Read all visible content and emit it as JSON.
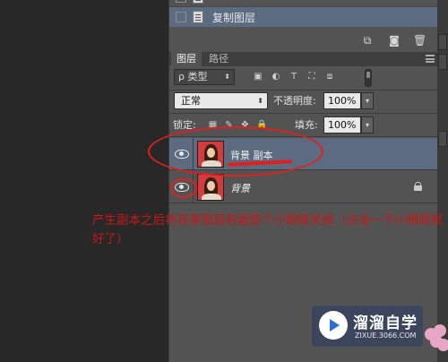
{
  "history": {
    "partial_item": "",
    "selected_item": "复制图层"
  },
  "layers_panel": {
    "tabs": [
      "图层",
      "路径"
    ],
    "filter": {
      "kind_label": "ρ 类型"
    },
    "blend_mode": "正常",
    "opacity_label": "不透明度:",
    "opacity_value": "100%",
    "lock_label": "锁定:",
    "fill_label": "填充:",
    "fill_value": "100%",
    "layers": [
      {
        "name": "背景 副本",
        "visible": true,
        "selected": true
      },
      {
        "name": "背景",
        "visible": true,
        "selected": false,
        "locked": true
      }
    ]
  },
  "annotation": {
    "text": "产生副本之后将背景图层前面那个小眼睛关掉（点击一下小眼睛就好了）",
    "color": "#d42020"
  },
  "watermark": {
    "title": "溜溜自学",
    "subtitle": "ZIXUE.3066.COM"
  }
}
